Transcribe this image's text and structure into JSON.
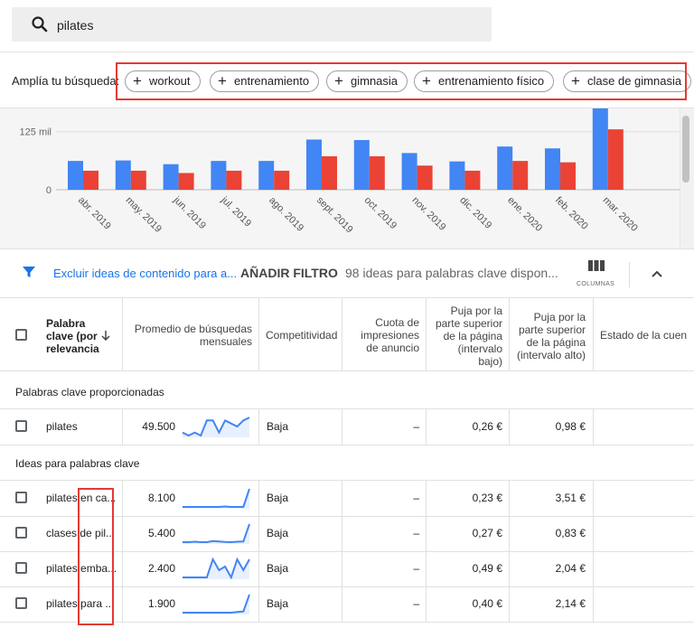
{
  "search": {
    "query": "pilates",
    "icon": "search-icon"
  },
  "broaden": {
    "label": "Amplía tu búsqueda:",
    "chips": [
      "workout",
      "entrenamiento",
      "gimnasia",
      "entrenamiento físico",
      "clase de gimnasia"
    ]
  },
  "chart_data": {
    "type": "bar",
    "categories": [
      "abr. 2019",
      "may. 2019",
      "jun. 2019",
      "jul. 2019",
      "ago. 2019",
      "sept. 2019",
      "oct. 2019",
      "nov. 2019",
      "dic. 2019",
      "ene. 2020",
      "feb. 2020",
      "mar. 2020"
    ],
    "series": [
      {
        "values": [
          62000,
          63000,
          55000,
          62000,
          62000,
          108000,
          107000,
          79000,
          61000,
          93000,
          89000,
          175000
        ],
        "color": "#4285f4"
      },
      {
        "values": [
          41000,
          41000,
          36000,
          41000,
          41000,
          72000,
          72000,
          52000,
          41000,
          62000,
          59000,
          130000
        ],
        "color": "#ea4335"
      }
    ],
    "yticks": [
      "125 mil",
      "0"
    ],
    "ylim": [
      0,
      175000
    ]
  },
  "filterbar": {
    "exclude_text": "Excluir ideas de contenido para a...",
    "add_filter": "AÑADIR FILTRO",
    "ideas_count": "98 ideas para palabras clave dispon...",
    "columns_label": "COLUMNAS"
  },
  "table": {
    "headers": {
      "keyword": "Palabra clave (por relevancia",
      "avg": "Promedio de búsquedas mensuales",
      "comp": "Competitividad",
      "share": "Cuota de impresiones de anuncio",
      "bid_low": "Puja por la parte superior de la página (intervalo bajo)",
      "bid_high": "Puja por la parte superior de la página (intervalo alto)",
      "status": "Estado de la cuen"
    },
    "section_provided": "Palabras clave proporcionadas",
    "section_ideas": "Ideas para palabras clave",
    "provided_rows": [
      {
        "keyword": "pilates",
        "avg": "49.500",
        "comp": "Baja",
        "share": "–",
        "bid_low": "0,26 €",
        "bid_high": "0,98 €",
        "trend": [
          5,
          4,
          5,
          4,
          9,
          9,
          5,
          9,
          8,
          7,
          9,
          10
        ]
      }
    ],
    "idea_rows": [
      {
        "keyword": "pilates en ca...",
        "avg": "8.100",
        "comp": "Baja",
        "share": "–",
        "bid_low": "0,23 €",
        "bid_high": "3,51 €",
        "trend": [
          1,
          1,
          1,
          1,
          1,
          1,
          1,
          1.2,
          1,
          1,
          1,
          9
        ]
      },
      {
        "keyword": "clases de pil...",
        "avg": "5.400",
        "comp": "Baja",
        "share": "–",
        "bid_low": "0,27 €",
        "bid_high": "0,83 €",
        "trend": [
          1,
          1,
          1.2,
          1,
          1,
          1.5,
          1.3,
          1.1,
          1,
          1.2,
          1.3,
          9
        ]
      },
      {
        "keyword": "pilates emba...",
        "avg": "2.400",
        "comp": "Baja",
        "share": "–",
        "bid_low": "0,49 €",
        "bid_high": "2,04 €",
        "trend": [
          2,
          2,
          2,
          2,
          2,
          7,
          4,
          5,
          2,
          7,
          4,
          7
        ]
      },
      {
        "keyword": "pilates para ...",
        "avg": "1.900",
        "comp": "Baja",
        "share": "–",
        "bid_low": "0,40 €",
        "bid_high": "2,14 €",
        "trend": [
          1,
          1,
          1,
          1,
          1,
          1,
          1,
          1,
          1,
          1.3,
          1.5,
          9
        ]
      }
    ]
  }
}
